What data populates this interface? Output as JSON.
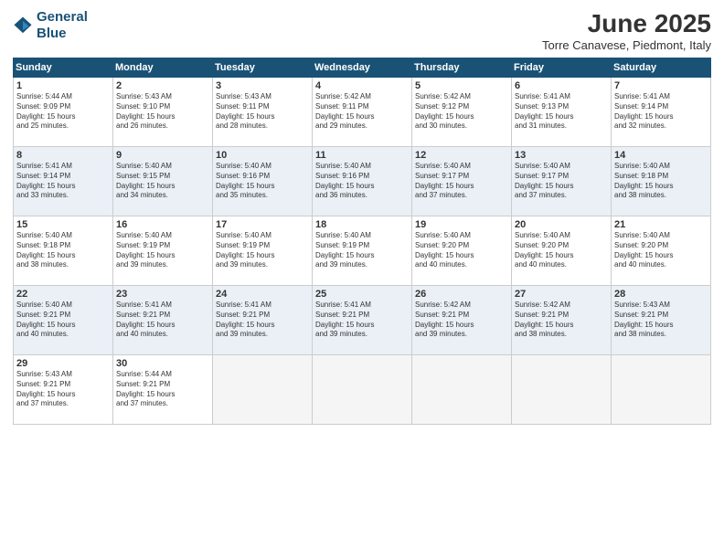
{
  "header": {
    "logo_line1": "General",
    "logo_line2": "Blue",
    "month": "June 2025",
    "location": "Torre Canavese, Piedmont, Italy"
  },
  "days_of_week": [
    "Sunday",
    "Monday",
    "Tuesday",
    "Wednesday",
    "Thursday",
    "Friday",
    "Saturday"
  ],
  "weeks": [
    {
      "alt": false,
      "days": [
        {
          "num": "1",
          "info": "Sunrise: 5:44 AM\nSunset: 9:09 PM\nDaylight: 15 hours\nand 25 minutes."
        },
        {
          "num": "2",
          "info": "Sunrise: 5:43 AM\nSunset: 9:10 PM\nDaylight: 15 hours\nand 26 minutes."
        },
        {
          "num": "3",
          "info": "Sunrise: 5:43 AM\nSunset: 9:11 PM\nDaylight: 15 hours\nand 28 minutes."
        },
        {
          "num": "4",
          "info": "Sunrise: 5:42 AM\nSunset: 9:11 PM\nDaylight: 15 hours\nand 29 minutes."
        },
        {
          "num": "5",
          "info": "Sunrise: 5:42 AM\nSunset: 9:12 PM\nDaylight: 15 hours\nand 30 minutes."
        },
        {
          "num": "6",
          "info": "Sunrise: 5:41 AM\nSunset: 9:13 PM\nDaylight: 15 hours\nand 31 minutes."
        },
        {
          "num": "7",
          "info": "Sunrise: 5:41 AM\nSunset: 9:14 PM\nDaylight: 15 hours\nand 32 minutes."
        }
      ]
    },
    {
      "alt": true,
      "days": [
        {
          "num": "8",
          "info": "Sunrise: 5:41 AM\nSunset: 9:14 PM\nDaylight: 15 hours\nand 33 minutes."
        },
        {
          "num": "9",
          "info": "Sunrise: 5:40 AM\nSunset: 9:15 PM\nDaylight: 15 hours\nand 34 minutes."
        },
        {
          "num": "10",
          "info": "Sunrise: 5:40 AM\nSunset: 9:16 PM\nDaylight: 15 hours\nand 35 minutes."
        },
        {
          "num": "11",
          "info": "Sunrise: 5:40 AM\nSunset: 9:16 PM\nDaylight: 15 hours\nand 36 minutes."
        },
        {
          "num": "12",
          "info": "Sunrise: 5:40 AM\nSunset: 9:17 PM\nDaylight: 15 hours\nand 37 minutes."
        },
        {
          "num": "13",
          "info": "Sunrise: 5:40 AM\nSunset: 9:17 PM\nDaylight: 15 hours\nand 37 minutes."
        },
        {
          "num": "14",
          "info": "Sunrise: 5:40 AM\nSunset: 9:18 PM\nDaylight: 15 hours\nand 38 minutes."
        }
      ]
    },
    {
      "alt": false,
      "days": [
        {
          "num": "15",
          "info": "Sunrise: 5:40 AM\nSunset: 9:18 PM\nDaylight: 15 hours\nand 38 minutes."
        },
        {
          "num": "16",
          "info": "Sunrise: 5:40 AM\nSunset: 9:19 PM\nDaylight: 15 hours\nand 39 minutes."
        },
        {
          "num": "17",
          "info": "Sunrise: 5:40 AM\nSunset: 9:19 PM\nDaylight: 15 hours\nand 39 minutes."
        },
        {
          "num": "18",
          "info": "Sunrise: 5:40 AM\nSunset: 9:19 PM\nDaylight: 15 hours\nand 39 minutes."
        },
        {
          "num": "19",
          "info": "Sunrise: 5:40 AM\nSunset: 9:20 PM\nDaylight: 15 hours\nand 40 minutes."
        },
        {
          "num": "20",
          "info": "Sunrise: 5:40 AM\nSunset: 9:20 PM\nDaylight: 15 hours\nand 40 minutes."
        },
        {
          "num": "21",
          "info": "Sunrise: 5:40 AM\nSunset: 9:20 PM\nDaylight: 15 hours\nand 40 minutes."
        }
      ]
    },
    {
      "alt": true,
      "days": [
        {
          "num": "22",
          "info": "Sunrise: 5:40 AM\nSunset: 9:21 PM\nDaylight: 15 hours\nand 40 minutes."
        },
        {
          "num": "23",
          "info": "Sunrise: 5:41 AM\nSunset: 9:21 PM\nDaylight: 15 hours\nand 40 minutes."
        },
        {
          "num": "24",
          "info": "Sunrise: 5:41 AM\nSunset: 9:21 PM\nDaylight: 15 hours\nand 39 minutes."
        },
        {
          "num": "25",
          "info": "Sunrise: 5:41 AM\nSunset: 9:21 PM\nDaylight: 15 hours\nand 39 minutes."
        },
        {
          "num": "26",
          "info": "Sunrise: 5:42 AM\nSunset: 9:21 PM\nDaylight: 15 hours\nand 39 minutes."
        },
        {
          "num": "27",
          "info": "Sunrise: 5:42 AM\nSunset: 9:21 PM\nDaylight: 15 hours\nand 38 minutes."
        },
        {
          "num": "28",
          "info": "Sunrise: 5:43 AM\nSunset: 9:21 PM\nDaylight: 15 hours\nand 38 minutes."
        }
      ]
    },
    {
      "alt": false,
      "days": [
        {
          "num": "29",
          "info": "Sunrise: 5:43 AM\nSunset: 9:21 PM\nDaylight: 15 hours\nand 37 minutes."
        },
        {
          "num": "30",
          "info": "Sunrise: 5:44 AM\nSunset: 9:21 PM\nDaylight: 15 hours\nand 37 minutes."
        },
        {
          "num": "",
          "info": ""
        },
        {
          "num": "",
          "info": ""
        },
        {
          "num": "",
          "info": ""
        },
        {
          "num": "",
          "info": ""
        },
        {
          "num": "",
          "info": ""
        }
      ]
    }
  ]
}
